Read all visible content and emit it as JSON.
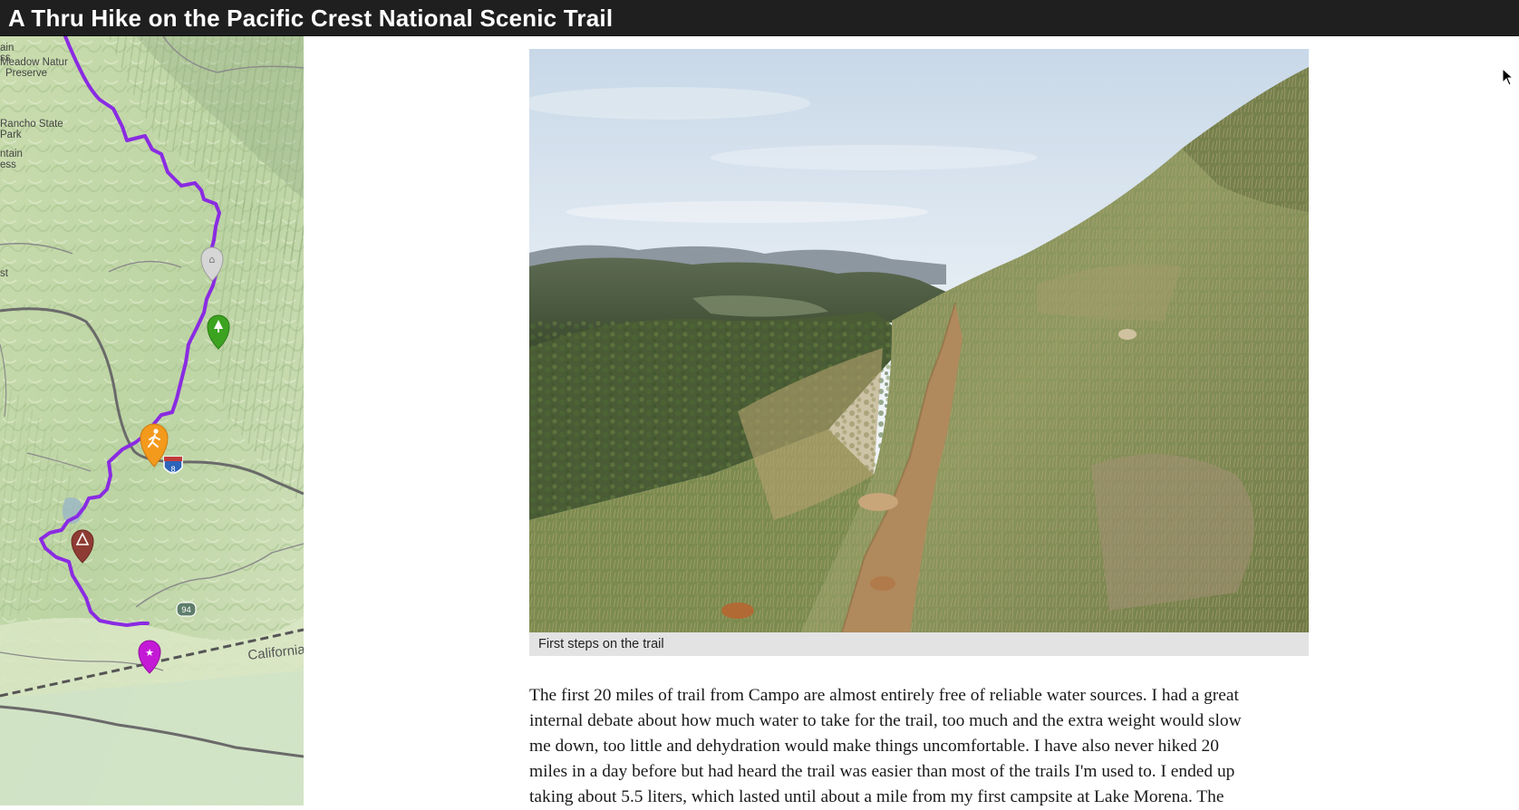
{
  "header": {
    "title": "A Thru Hike on the Pacific Crest National Scenic Trail"
  },
  "map": {
    "labels": {
      "meadow_preserve_1": "Meadow Natur",
      "meadow_preserve_2": "Preserve",
      "rancho_state_1": "Rancho State",
      "rancho_state_2": "Park",
      "mountain_1": "ntain",
      "mountain_2": "ess",
      "top_fragment_1": "ain",
      "top_fragment_2": "ss",
      "st_fragment": "st",
      "interstate": "8",
      "route": "94",
      "state": "California"
    },
    "route_color": "#8a2be2",
    "markers": [
      {
        "name": "shelter-marker",
        "color": "#d6d6d6",
        "glyph": "⌂"
      },
      {
        "name": "forest-marker",
        "color": "#3ca320",
        "glyph": "▲"
      },
      {
        "name": "hiker-marker",
        "color": "#f39a1d",
        "glyph": "✲"
      },
      {
        "name": "campsite-marker",
        "color": "#8e3b33",
        "glyph": "△"
      },
      {
        "name": "trailhead-marker",
        "color": "#c41ad6",
        "glyph": "★"
      }
    ]
  },
  "article": {
    "photo_caption": "First steps on the trail",
    "paragraph_lines": [
      "The first 20 miles of trail from Campo are almost entirely free of reliable water sources.  I had a great",
      "internal debate about how much water to take for the trail, too much and the extra weight would slow",
      "me down, too little and dehydration would make things uncomfortable.  I have also never hiked 20",
      "miles in a day before but had heard the trail was easier than most of the trails I'm used to.  I ended up",
      "taking about 5.5 liters, which lasted until about a mile from my first campsite at Lake Morena.  The"
    ]
  }
}
